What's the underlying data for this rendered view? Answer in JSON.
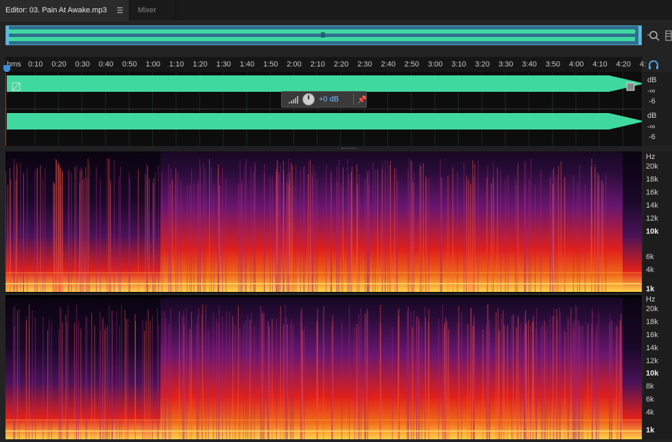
{
  "tabs": {
    "editor_label": "Editor: 03. Pain At Awake.mp3",
    "editor_menu_icon": "panel-menu-icon",
    "mixer_label": "Mixer"
  },
  "toolbar_icons": [
    "zoom-to-selection-icon",
    "panel-options-icon"
  ],
  "ruler": {
    "unit": "hms",
    "ticks": [
      "0:10",
      "0:20",
      "0:30",
      "0:40",
      "0:50",
      "1:00",
      "1:10",
      "1:20",
      "1:30",
      "1:40",
      "1:50",
      "2:00",
      "2:10",
      "2:20",
      "2:30",
      "2:40",
      "2:50",
      "3:00",
      "3:10",
      "3:20",
      "3:30",
      "3:40",
      "3:50",
      "4:00",
      "4:10",
      "4:20",
      "4:"
    ]
  },
  "waveform": {
    "color": "#3fd9a0",
    "channel1_db": [
      "dB",
      "-∞",
      "-6"
    ],
    "channel2_db": [
      "dB",
      "-∞",
      "-6"
    ]
  },
  "hud": {
    "value": "+0 dB"
  },
  "spectral": {
    "channel1_hz": [
      "Hz",
      "20k",
      "18k",
      "16k",
      "14k",
      "12k",
      "10k",
      "6k",
      "4k",
      "1k"
    ],
    "channel2_hz": [
      "Hz",
      "20k",
      "18k",
      "16k",
      "14k",
      "12k",
      "10k",
      "8k",
      "6k",
      "4k",
      "1k"
    ],
    "colors": {
      "low": "#ffd24a",
      "mid": "#e0201a",
      "high": "#6a1670",
      "top": "#160822"
    }
  }
}
